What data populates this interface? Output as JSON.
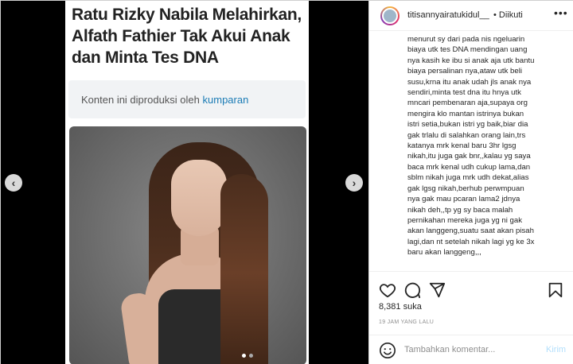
{
  "article": {
    "headline_lines": [
      "Ratu Rizky Nabila Melahirkan,",
      "Alfath Fathier Tak Akui Anak",
      "dan Minta Tes DNA"
    ],
    "source_prefix": "Konten ini diproduksi oleh",
    "source_name": "kumparan"
  },
  "carousel": {
    "prev_icon": "‹",
    "next_icon": "›",
    "slides": 2,
    "active": 0
  },
  "header": {
    "username": "titisannyairatukidul__",
    "follow_text": "• Diikuti",
    "more": "•••"
  },
  "caption_lines": [
    "menurut sy dari pada nis ngeluarin",
    "biaya utk tes DNA mendingan uang",
    "nya kasih ke ibu si anak aja utk bantu",
    "biaya persalinan nya,ataw utk beli",
    "susu,krna itu anak udah jls anak nya",
    "sendiri,minta test dna itu hnya utk",
    "mncari pembenaran aja,supaya org",
    "mengira klo mantan istrinya bukan",
    "istri setia,bukan istri yg baik,biar dia",
    "gak trlalu di salahkan orang lain,trs",
    "katanya mrk kenal baru 3hr lgsg",
    "nikah,itu juga gak bnr,,kalau yg saya",
    "baca mrk kenal udh cukup lama,dan",
    "sblm nikah juga mrk udh dekat,alias",
    "gak lgsg nikah,berhub perwmpuan",
    "nya gak mau pcaran lama2 jdnya",
    "nikah deh,,tp yg sy baca malah",
    "pernikahan mereka juga yg ni gak",
    "akan langgeng,suatu saat akan pisah",
    "lagi,dan nt setelah nikah lagi yg ke 3x",
    "baru akan langgeng,,,"
  ],
  "post": {
    "likes": "8,381 suka",
    "time": "19 JAM YANG LALU"
  },
  "comment": {
    "placeholder": "Tambahkan komentar...",
    "send": "Kirim"
  },
  "icons": [
    "heart-icon",
    "comment-icon",
    "share-icon",
    "bookmark-icon",
    "emoji-icon",
    "more-options-icon"
  ],
  "colors": {
    "link": "#1a7bb5",
    "send_disabled": "#b2dffc",
    "muted": "#8e8e8e",
    "text": "#262626"
  }
}
